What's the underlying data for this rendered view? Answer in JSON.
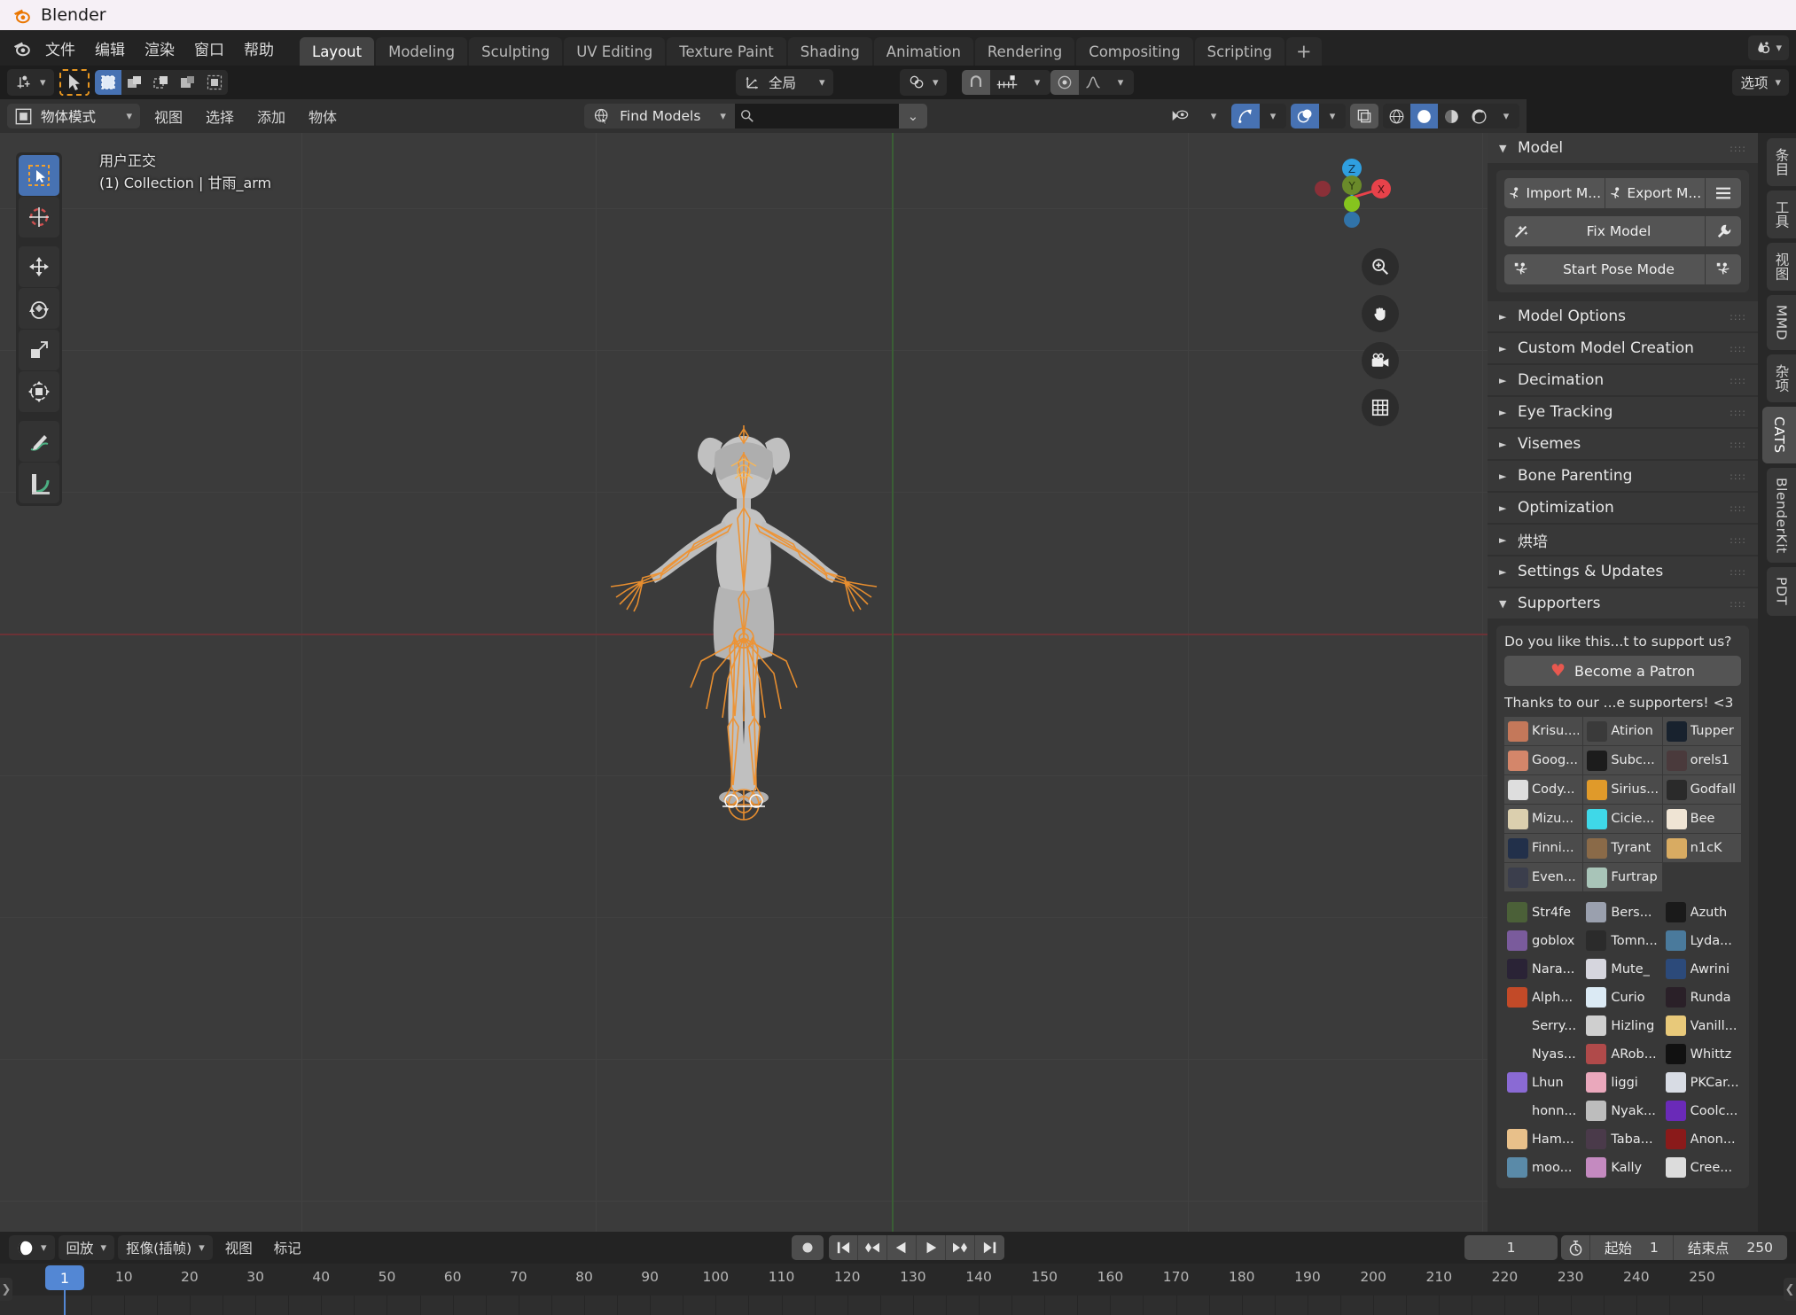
{
  "window": {
    "title": "Blender",
    "logo_icon": "blender-logo-icon"
  },
  "topbar": {
    "menus": [
      "文件",
      "编辑",
      "渲染",
      "窗口",
      "帮助"
    ],
    "workspace_tabs": [
      {
        "label": "Layout",
        "active": true
      },
      {
        "label": "Modeling",
        "active": false
      },
      {
        "label": "Sculpting",
        "active": false
      },
      {
        "label": "UV Editing",
        "active": false
      },
      {
        "label": "Texture Paint",
        "active": false
      },
      {
        "label": "Shading",
        "active": false
      },
      {
        "label": "Animation",
        "active": false
      },
      {
        "label": "Rendering",
        "active": false
      },
      {
        "label": "Compositing",
        "active": false
      },
      {
        "label": "Scripting",
        "active": false
      }
    ],
    "add_workspace_label": "+",
    "scene_chip_icon": "scene-drop-icon"
  },
  "toolheader": {
    "editor_type_icon": "editor-type-icon",
    "cursor_icon": "select-cursor-icon",
    "select_modes": [
      "set-select-icon",
      "extend-select-icon",
      "subtract-select-icon",
      "invert-select-icon",
      "intersect-select-icon"
    ],
    "transform_orientation": "全局",
    "transform_orientation_icon": "orientation-axis-icon",
    "pivot_icon": "pivot-point-icon",
    "snap_magnet_icon": "snap-magnet-icon",
    "snap_target_icon": "snap-increment-icon",
    "proportional_icon": "proportional-edit-icon",
    "proportional_falloff_icon": "falloff-curve-icon",
    "options_label": "选项"
  },
  "viewport_header": {
    "mode": "物体模式",
    "mode_icon": "object-mode-icon",
    "menus": [
      "视图",
      "选择",
      "添加",
      "物体"
    ],
    "find_models_label": "Find Models",
    "find_models_icon": "globe-cursor-icon",
    "search_value": "",
    "search_placeholder": "",
    "search_icon": "magnifier-icon",
    "dropdown_icon": "chevron-down-icon",
    "right_icons": [
      "visibility-eye-icon",
      "chevron-down-icon",
      "gizmo-icon",
      "chevron-down-icon",
      "overlays-icon",
      "chevron-down-icon",
      "xray-toggle-icon",
      "shading-wireframe-icon",
      "shading-solid-icon",
      "shading-material-icon",
      "shading-rendered-icon",
      "chevron-down-icon"
    ]
  },
  "viewport": {
    "view_label": "用户正交",
    "collection_label": "(1) Collection | 甘雨_arm",
    "gizmo_axes": [
      "Z",
      "Y",
      "X"
    ],
    "nav_buttons": [
      "zoom-icon",
      "pan-hand-icon",
      "camera-view-icon",
      "toggle-ortho-grid-icon"
    ],
    "left_tools": [
      {
        "name": "tweak-select-tool",
        "active": true
      },
      {
        "name": "cursor-tool",
        "active": false
      },
      {
        "name": "move-tool",
        "active": false
      },
      {
        "name": "rotate-tool",
        "active": false
      },
      {
        "name": "scale-tool",
        "active": false
      },
      {
        "name": "transform-tool",
        "active": false
      },
      {
        "name": "annotate-tool",
        "active": false
      },
      {
        "name": "measure-tool",
        "active": false
      }
    ]
  },
  "sidebar": {
    "vertical_tabs": [
      {
        "label": "条目",
        "active": false
      },
      {
        "label": "工具",
        "active": false
      },
      {
        "label": "视图",
        "active": false
      },
      {
        "label": "MMD",
        "active": false
      },
      {
        "label": "杂项",
        "active": false
      },
      {
        "label": "CATS",
        "active": true
      },
      {
        "label": "BlenderKit",
        "active": false
      },
      {
        "label": "PDT",
        "active": false
      }
    ],
    "panels": [
      {
        "label": "Model",
        "open": true
      },
      {
        "label": "Model Options",
        "open": false
      },
      {
        "label": "Custom Model Creation",
        "open": false
      },
      {
        "label": "Decimation",
        "open": false
      },
      {
        "label": "Eye Tracking",
        "open": false
      },
      {
        "label": "Visemes",
        "open": false
      },
      {
        "label": "Bone Parenting",
        "open": false
      },
      {
        "label": "Optimization",
        "open": false
      },
      {
        "label": "烘培",
        "open": false
      },
      {
        "label": "Settings & Updates",
        "open": false
      },
      {
        "label": "Supporters",
        "open": true
      }
    ],
    "model_panel": {
      "import_label": "Import M...",
      "import_icon": "armature-import-icon",
      "export_label": "Export M...",
      "export_icon": "armature-export-icon",
      "menu_icon": "hamburger-menu-icon",
      "fix_model_label": "Fix Model",
      "fix_model_icon": "magic-wand-icon",
      "fix_model_settings_icon": "wrench-icon",
      "pose_mode_label": "Start Pose Mode",
      "pose_mode_icon": "pose-armature-icon",
      "pose_mode_extra_icon": "pose-armature-icon"
    },
    "supporters": {
      "prompt": "Do you like this...t to support us?",
      "patron_label": "Become a Patron",
      "patron_icon": "heart-icon",
      "thanks": "Thanks to our ...e supporters! <3",
      "top_supporters": [
        {
          "name": "Krisu....",
          "color": "#c4785a"
        },
        {
          "name": "Atirion",
          "color": "#3a3a3a"
        },
        {
          "name": "Tupper",
          "color": "#18222e"
        },
        {
          "name": "Goog...",
          "color": "#d4866a"
        },
        {
          "name": "Subc...",
          "color": "#1c1c1c"
        },
        {
          "name": "orels1",
          "color": "#4a3a3c"
        },
        {
          "name": "Cody...",
          "color": "#dedede"
        },
        {
          "name": "Sirius...",
          "color": "#e09a2a"
        },
        {
          "name": "Godfall",
          "color": "#2a2a2a"
        },
        {
          "name": "Mizu...",
          "color": "#dbcfae"
        },
        {
          "name": "Cicie...",
          "color": "#3fd8e8"
        },
        {
          "name": "Bee",
          "color": "#efe4d4"
        },
        {
          "name": "Finni...",
          "color": "#22304a"
        },
        {
          "name": "Tyrant",
          "color": "#8a6a48"
        },
        {
          "name": "n1cK",
          "color": "#d8ab62"
        },
        {
          "name": "Even...",
          "color": "#3b3e4c"
        },
        {
          "name": "Furtrap",
          "color": "#a8c4b8"
        }
      ],
      "other_supporters": [
        {
          "name": "Str4fe",
          "color": "#4b6038"
        },
        {
          "name": "Bers...",
          "color": "#9aa0ae"
        },
        {
          "name": "Azuth",
          "color": "#1a1a1a"
        },
        {
          "name": "goblox",
          "color": "#7a5b9c"
        },
        {
          "name": "Tomn...",
          "color": "#2b2b2b"
        },
        {
          "name": "Lyda...",
          "color": "#4a7a9c"
        },
        {
          "name": "Nara...",
          "color": "#2a2336"
        },
        {
          "name": "Mute_",
          "color": "#d6d6de"
        },
        {
          "name": "Awrini",
          "color": "#2c4a7a"
        },
        {
          "name": "Alph...",
          "color": "#c24a28"
        },
        {
          "name": "Curio",
          "color": "#dbeaf4"
        },
        {
          "name": "Runda",
          "color": "#2a2028"
        },
        {
          "name": "Serry...",
          "color": "transparent"
        },
        {
          "name": "Hizling",
          "color": "#cfcfcf"
        },
        {
          "name": "Vanill...",
          "color": "#e8c97a"
        },
        {
          "name": "Nyas...",
          "color": "transparent"
        },
        {
          "name": "ARob...",
          "color": "#b04a4a"
        },
        {
          "name": "Whittz",
          "color": "#111111"
        },
        {
          "name": "Lhun",
          "color": "#8a6ad4"
        },
        {
          "name": "liggi",
          "color": "#eaa8bc"
        },
        {
          "name": "PKCar...",
          "color": "#d8dce4"
        },
        {
          "name": "honn...",
          "color": "transparent"
        },
        {
          "name": "Nyak...",
          "color": "#bdbdbd"
        },
        {
          "name": "Coolc...",
          "color": "#6a2ab8"
        },
        {
          "name": "Ham...",
          "color": "#e8c08a"
        },
        {
          "name": "Taba...",
          "color": "#4a3a4a"
        },
        {
          "name": "Anon...",
          "color": "#8a1a1a"
        },
        {
          "name": "moo...",
          "color": "#5a8aa8"
        },
        {
          "name": "Kally",
          "color": "#c48ac0"
        },
        {
          "name": "Cree...",
          "color": "#dcdcdc"
        }
      ]
    }
  },
  "timeline": {
    "editor_icon": "timeline-editor-icon",
    "menus": [
      "回放",
      "抠像(插帧)",
      "视图",
      "标记"
    ],
    "playback_label": "回放",
    "keying_label": "抠像(插帧)",
    "view_label": "视图",
    "marker_label": "标记",
    "record_icon": "auto-keying-icon",
    "transport_icons": [
      "jump-start-icon",
      "prev-keyframe-icon",
      "play-reverse-icon",
      "play-icon",
      "next-keyframe-icon",
      "jump-end-icon"
    ],
    "current_frame": "1",
    "use_preview_icon": "stopwatch-icon",
    "start_label": "起始",
    "start_value": "1",
    "end_label": "结束点",
    "end_value": "250",
    "playhead_frame": "1",
    "ruler_ticks": [
      "10",
      "20",
      "30",
      "40",
      "50",
      "60",
      "70",
      "80",
      "90",
      "100",
      "110",
      "120",
      "130",
      "140",
      "150",
      "160",
      "170",
      "180",
      "190",
      "200",
      "210",
      "220",
      "230",
      "240",
      "250"
    ]
  },
  "colors": {
    "accent_blue": "#4772b3",
    "playhead_blue": "#5387d4",
    "bone_orange": "#e8952f",
    "axis_x_red": "#e8424a",
    "axis_y_green": "#8bc34a",
    "axis_z_blue": "#2f9fe0",
    "heart_red": "#e8584f"
  }
}
